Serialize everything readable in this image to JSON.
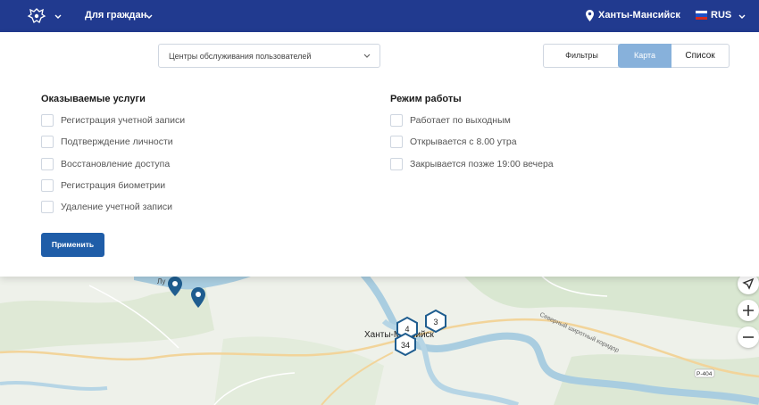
{
  "header": {
    "nav_label": "Для граждан",
    "location": "Ханты-Мансийск",
    "language": "RUS",
    "icons": [
      "emblem-icon",
      "chevron-down-icon",
      "location-pin-icon",
      "russia-flag-icon"
    ]
  },
  "toolbar": {
    "category_select": "Центры обслуживания пользователей",
    "filters_label": "Фильтры",
    "map_tab": "Карта",
    "list_tab": "Список"
  },
  "filters": {
    "services": {
      "title": "Оказываемые услуги",
      "options": [
        "Регистрация учетной записи",
        "Подтверждение личности",
        "Восстановление доступа",
        "Регистрация биометрии",
        "Удаление учетной записи"
      ]
    },
    "schedule": {
      "title": "Режим работы",
      "options": [
        "Работает по выходным",
        "Открывается с 8.00 утра",
        "Закрывается позже 19:00 вечера"
      ]
    },
    "apply_label": "Применить"
  },
  "map": {
    "city_label": "Ханты-Мансийск",
    "town_label": "Лу",
    "road_label": "Северный широтный коридор",
    "road_badge": "Р-404",
    "clusters": [
      "4",
      "3",
      "34"
    ],
    "controls": [
      "navigate-icon",
      "zoom-in-icon",
      "zoom-out-icon"
    ]
  },
  "colors": {
    "header_bg": "#213a8f",
    "accent": "#1f5da8",
    "map_tab_active": "#87b1db",
    "marker": "#1f5d8f"
  }
}
